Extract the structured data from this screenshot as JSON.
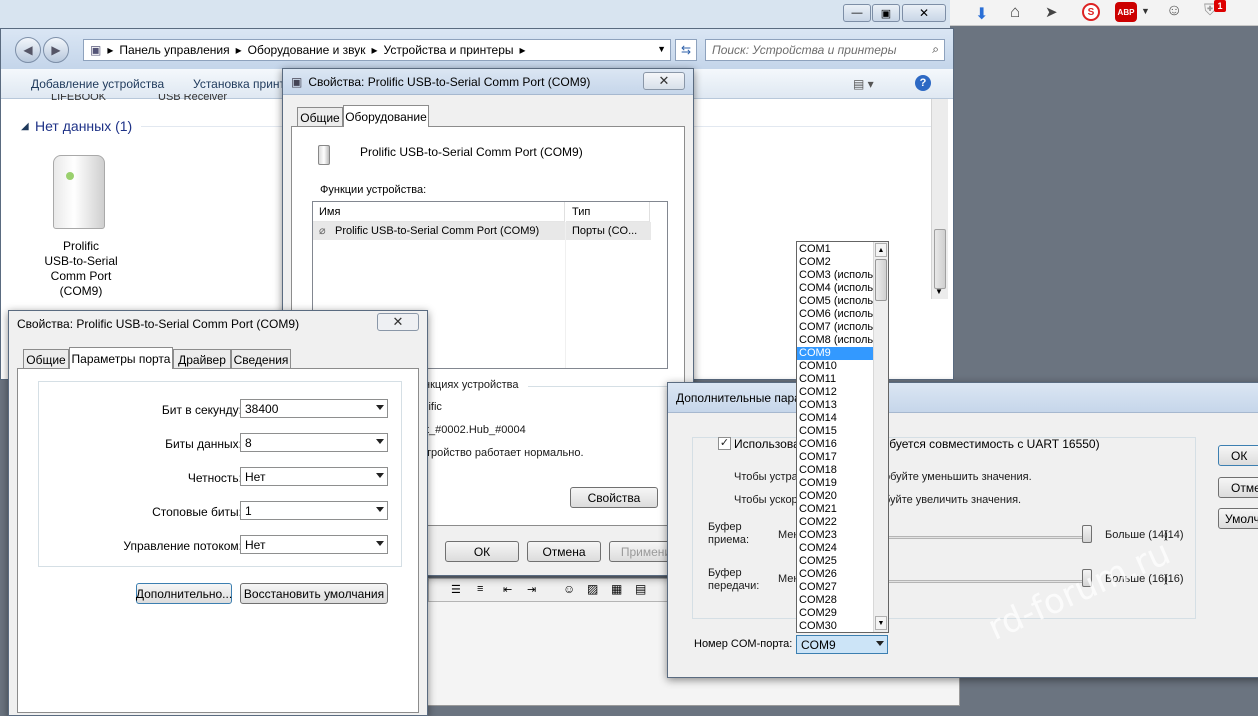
{
  "browser_bar": {
    "badge": "1"
  },
  "explorer": {
    "breadcrumb": [
      "Панель управления",
      "Оборудование и звук",
      "Устройства и принтеры"
    ],
    "search_placeholder": "Поиск: Устройства и принтеры",
    "toolbar": {
      "add_device": "Добавление устройства",
      "install_printer": "Установка принт"
    },
    "partial_labels": {
      "left": "LIFEBOOK",
      "right": "USB Receiver"
    },
    "group_header": "Нет данных (1)",
    "device_label": [
      "Prolific",
      "USB-to-Serial",
      "Comm Port",
      "(COM9)"
    ]
  },
  "hw_dialog": {
    "title": "Свойства: Prolific USB-to-Serial Comm Port (COM9)",
    "tabs": [
      "Общие",
      "Оборудование"
    ],
    "device_name": "Prolific USB-to-Serial Comm Port (COM9)",
    "functions_label": "Функции устройства:",
    "columns": [
      "Имя",
      "Тип"
    ],
    "row": {
      "name": "Prolific USB-to-Serial Comm Port (COM9)",
      "type": "Порты (CO..."
    },
    "summary_header": "нкциях устройства",
    "summary_lines": [
      "lific",
      "t_#0002.Hub_#0004",
      "тройство работает нормально."
    ],
    "properties_button": "Свойства",
    "ok": "ОК",
    "cancel": "Отмена",
    "apply": "Примени"
  },
  "port_dialog": {
    "title": "Свойства: Prolific USB-to-Serial Comm Port (COM9)",
    "tabs": [
      "Общие",
      "Параметры порта",
      "Драйвер",
      "Сведения"
    ],
    "fields": [
      {
        "label": "Бит в секунду:",
        "value": "38400"
      },
      {
        "label": "Биты данных:",
        "value": "8"
      },
      {
        "label": "Четность:",
        "value": "Нет"
      },
      {
        "label": "Стоповые биты:",
        "value": "1"
      },
      {
        "label": "Управление потоком:",
        "value": "Нет"
      }
    ],
    "advanced_button": "Дополнительно...",
    "restore_button": "Восстановить умолчания"
  },
  "advanced_dialog": {
    "title": "Дополнительные пара",
    "checkbox_label_a": "Использова",
    "checkbox_label_b": "ребуется совместимость с UART 16550)",
    "hint1_a": "Чтобы устра",
    "hint1_b": "обуйте уменьшить значения.",
    "hint2_a": "Чтобы ускор",
    "hint2_b": "буйте увеличить значения.",
    "rx_label": [
      "Буфер",
      "приема:"
    ],
    "tx_label": [
      "Буфер",
      "передачи:"
    ],
    "min_label": "Мен",
    "rx_max": "Больше (14)",
    "rx_value": "(14)",
    "tx_max": "Больше (16)",
    "tx_value": "(16)",
    "rx_level": 1.0,
    "tx_level": 1.0,
    "com_label": "Номер COM-порта:",
    "com_value": "COM9",
    "side_buttons": [
      "ОК",
      "Отме",
      "Умолч"
    ]
  },
  "com_list": [
    "COM1",
    "COM2",
    "COM3 (исполь",
    "COM4 (исполь",
    "COM5 (исполь",
    "COM6 (исполь",
    "COM7 (исполь",
    "COM8 (исполь",
    "COM9",
    "COM10",
    "COM11",
    "COM12",
    "COM13",
    "COM14",
    "COM15",
    "COM16",
    "COM17",
    "COM18",
    "COM19",
    "COM20",
    "COM21",
    "COM22",
    "COM23",
    "COM24",
    "COM25",
    "COM26",
    "COM27",
    "COM28",
    "COM29",
    "COM30"
  ],
  "com_selected": "COM9",
  "watermark": "rd-forum.ru"
}
